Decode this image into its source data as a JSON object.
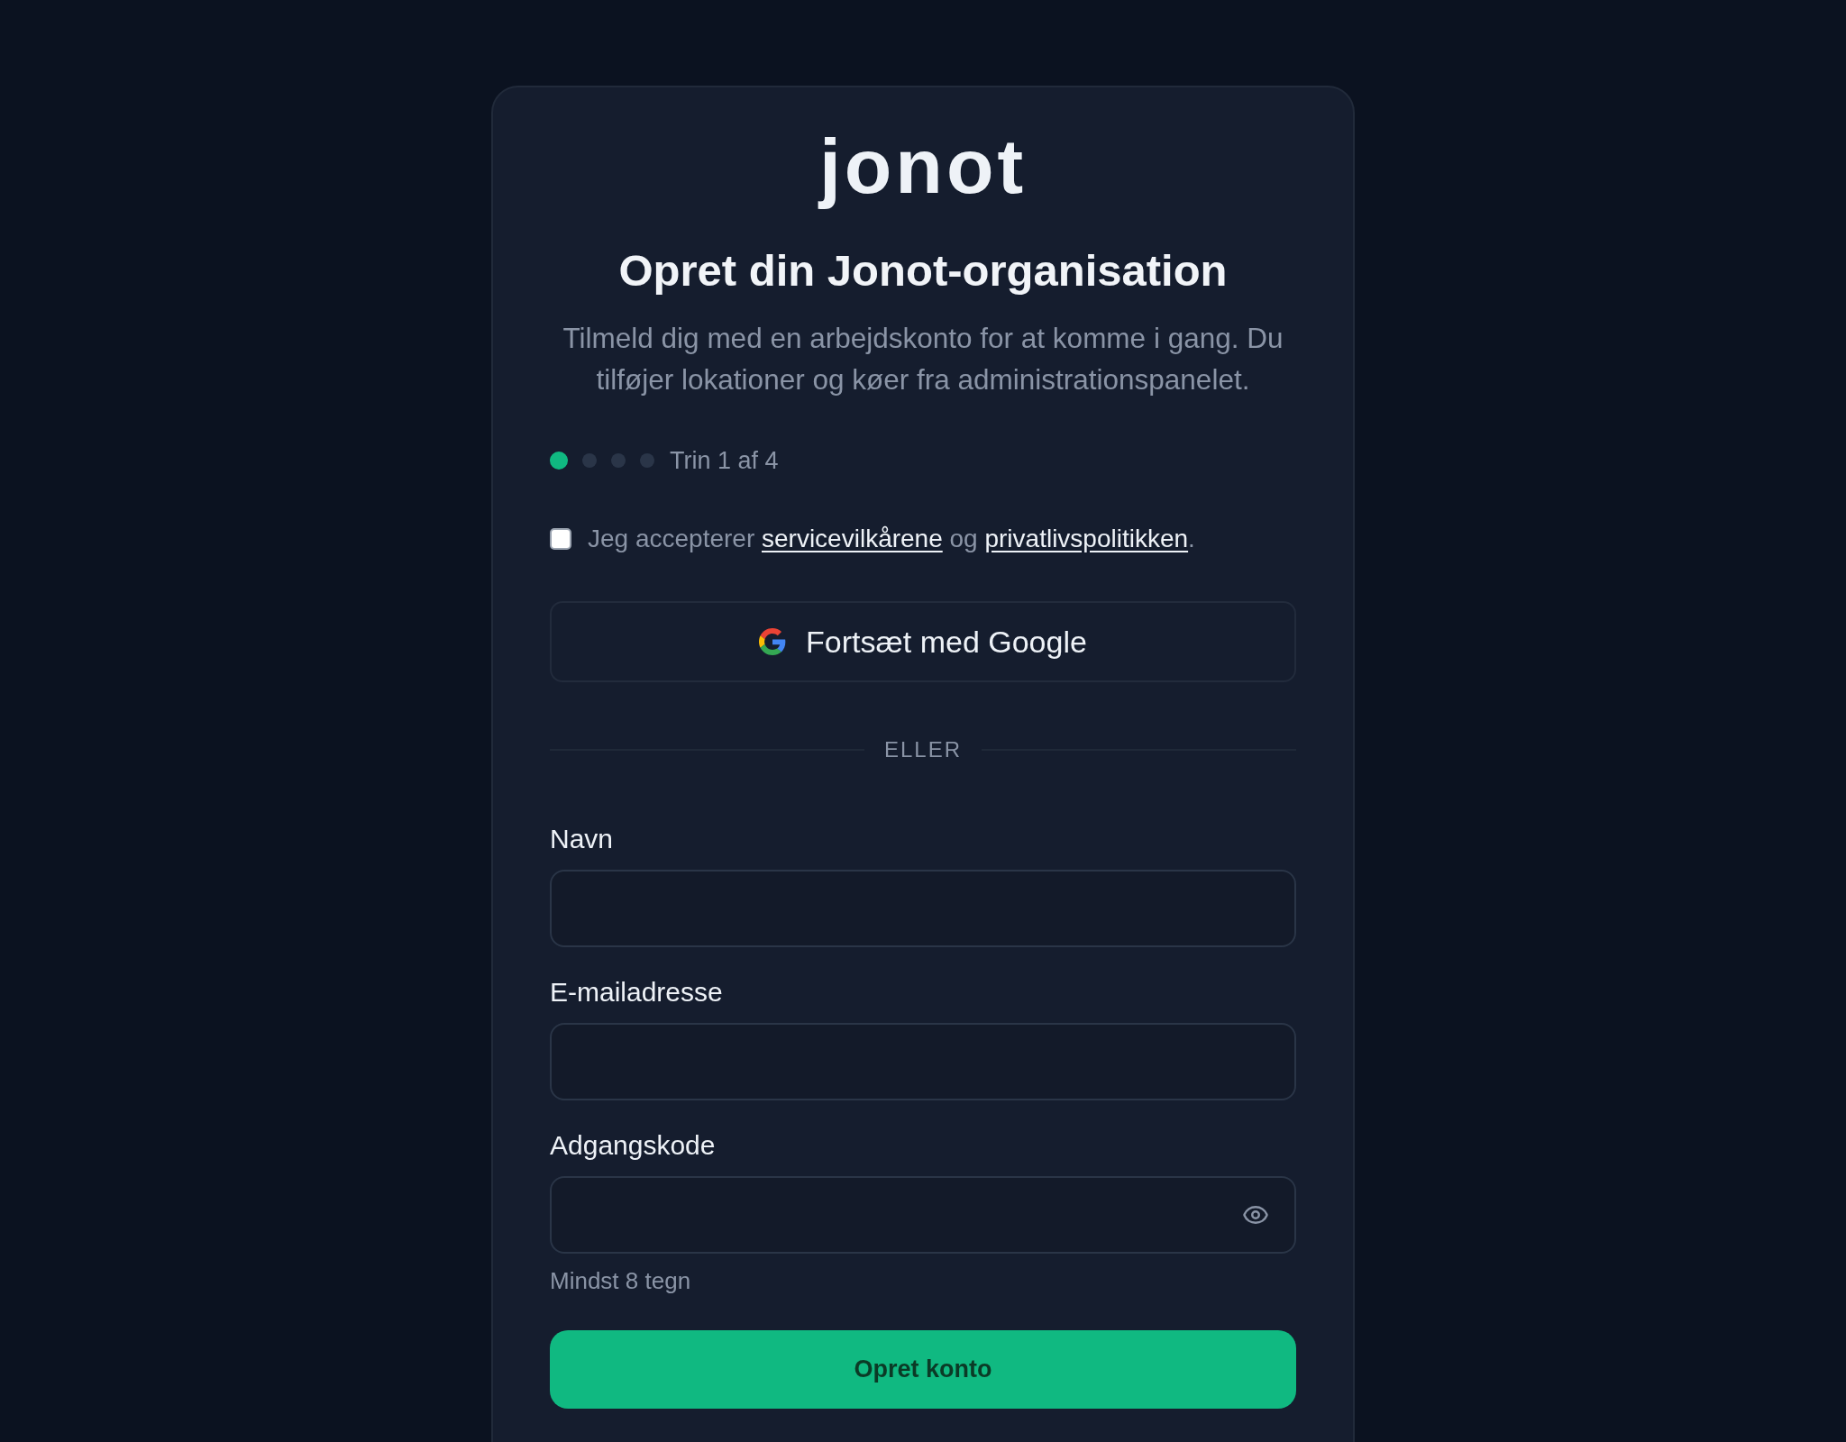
{
  "logo": {
    "text": "jonot"
  },
  "heading": "Opret din Jonot-organisation",
  "subtitle": "Tilmeld dig med en arbejdskonto for at komme i gang. Du tilføjer lokationer og køer fra administrationspanelet.",
  "progress": {
    "steps": [
      {
        "selected": true
      },
      {
        "selected": false
      },
      {
        "selected": false
      },
      {
        "selected": false
      }
    ],
    "label": "Trin 1 af 4"
  },
  "terms": {
    "checked": false,
    "parts": [
      {
        "kind": "text",
        "text": "Jeg accepterer "
      },
      {
        "kind": "link",
        "text": "servicevilkårene"
      },
      {
        "kind": "text",
        "text": " og "
      },
      {
        "kind": "link",
        "text": "privatlivspolitikken"
      },
      {
        "kind": "text",
        "text": "."
      }
    ]
  },
  "google_button": {
    "label": "Fortsæt med Google"
  },
  "divider": {
    "label": "ELLER"
  },
  "fields": [
    {
      "kind": "text",
      "label": "Navn"
    },
    {
      "kind": "email",
      "label": "E-mailadresse"
    },
    {
      "kind": "password",
      "label": "Adgangskode",
      "hint": "Mindst 8 tegn"
    }
  ],
  "submit_button": {
    "label": "Opret konto"
  }
}
